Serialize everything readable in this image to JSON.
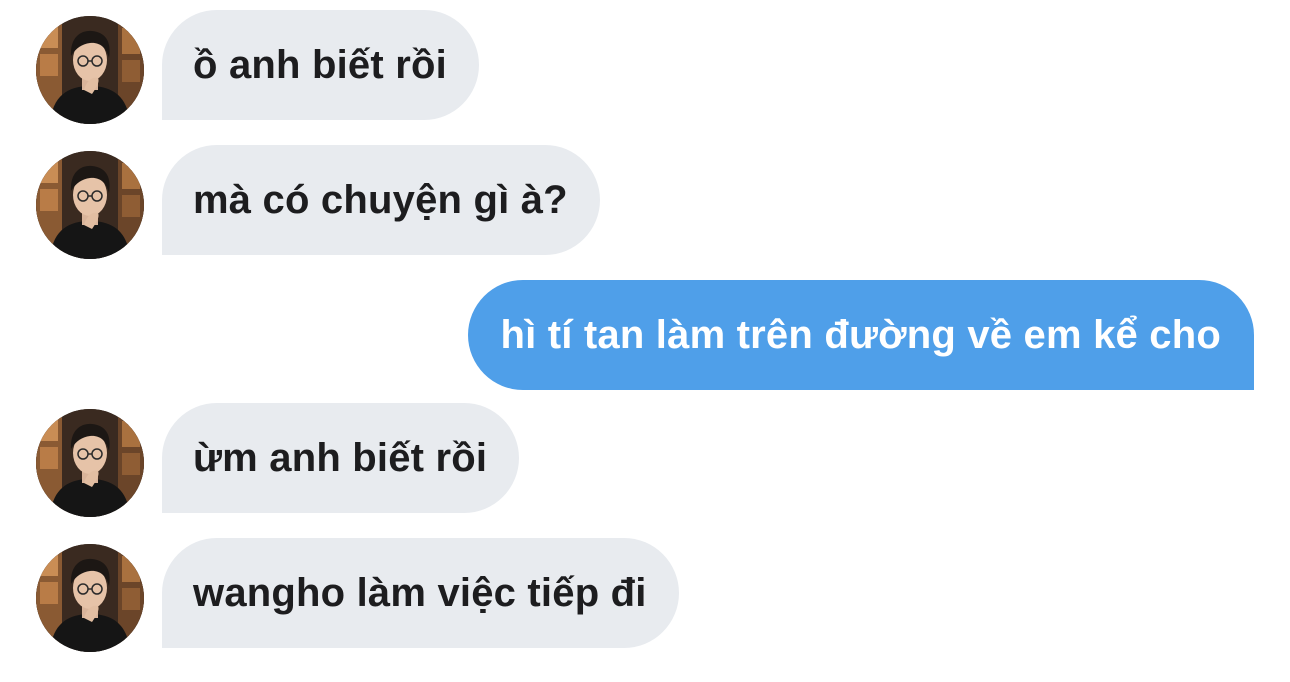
{
  "colors": {
    "incoming_bubble": "#e8ebef",
    "outgoing_bubble": "#4f9fe9",
    "incoming_text": "#1d1d1f",
    "outgoing_text": "#ffffff"
  },
  "messages": [
    {
      "direction": "incoming",
      "text": "ồ anh biết rồi",
      "has_avatar": true,
      "avatar_icon": "contact-avatar"
    },
    {
      "direction": "incoming",
      "text": "mà có chuyện gì à?",
      "has_avatar": true,
      "avatar_icon": "contact-avatar"
    },
    {
      "direction": "outgoing",
      "text": "hì tí tan làm trên đường về em kể cho",
      "has_avatar": false
    },
    {
      "direction": "incoming",
      "text": "ừm anh biết rồi",
      "has_avatar": true,
      "avatar_icon": "contact-avatar"
    },
    {
      "direction": "incoming",
      "text": "wangho làm việc tiếp đi",
      "has_avatar": true,
      "avatar_icon": "contact-avatar"
    }
  ]
}
